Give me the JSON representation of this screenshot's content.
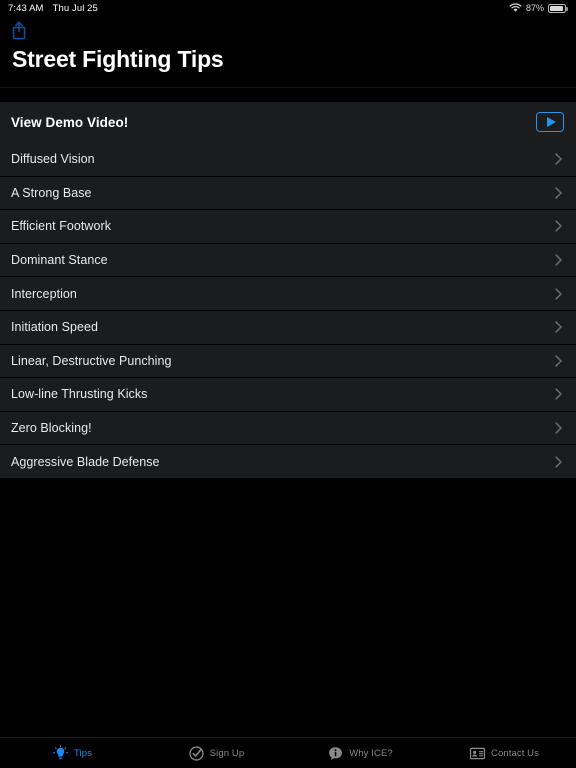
{
  "status_bar": {
    "time": "7:43 AM",
    "date": "Thu Jul 25",
    "wifi_icon": "wifi-icon",
    "battery_percent": "87%",
    "battery_icon": "battery-icon"
  },
  "header": {
    "share_icon": "share-icon",
    "title": "Street Fighting Tips"
  },
  "demo_row": {
    "label": "View Demo Video!",
    "play_icon": "play-icon",
    "accent_color": "#2196f3"
  },
  "list": {
    "chevron_icon": "chevron-right-icon",
    "items": [
      {
        "label": "Diffused Vision"
      },
      {
        "label": "A Strong Base"
      },
      {
        "label": "Efficient Footwork"
      },
      {
        "label": "Dominant Stance"
      },
      {
        "label": "Interception"
      },
      {
        "label": "Initiation Speed"
      },
      {
        "label": "Linear, Destructive Punching"
      },
      {
        "label": "Low-line Thrusting Kicks"
      },
      {
        "label": "Zero Blocking!"
      },
      {
        "label": "Aggressive Blade Defense"
      }
    ]
  },
  "tab_bar": {
    "active_color": "#1b8cf5",
    "inactive_color": "#8a8a8e",
    "tabs": [
      {
        "label": "Tips",
        "icon": "lightbulb-icon",
        "active": true
      },
      {
        "label": "Sign Up",
        "icon": "check-circle-icon",
        "active": false
      },
      {
        "label": "Why ICE?",
        "icon": "info-bubble-icon",
        "active": false
      },
      {
        "label": "Contact Us",
        "icon": "contact-card-icon",
        "active": false
      }
    ]
  }
}
